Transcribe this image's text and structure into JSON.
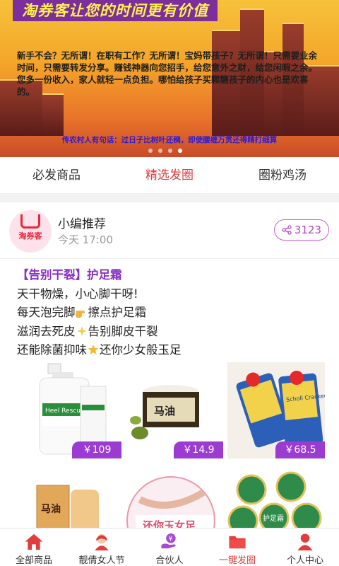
{
  "banner": {
    "title": "淘券客让您的时间更有价值",
    "text": "新手不会？无所谓！在职有工作？无所谓！宝妈带孩子？无所谓！只需要业余时间，只需要转发分享。赚钱神器向您招手，给您意外之财，给您闲暇之余。您多一份收入，家人就轻一点负担。哪怕给孩子买颗糖孩子的内心也是欢喜的。",
    "subtext": "传农村人有句话：过日子比树叶还稠，即使腰缠万贯还得精打细算"
  },
  "tabs": [
    {
      "label": "必发商品",
      "active": false
    },
    {
      "label": "精选发圈",
      "active": true
    },
    {
      "label": "圈粉鸡汤",
      "active": false
    }
  ],
  "post": {
    "avatar_text": "淘券客",
    "author": "小编推荐",
    "time": "今天 17:00",
    "share_count": "3123",
    "headline": "【告别干裂】护足霜",
    "lines": [
      "天干物燥，小心脚干呀!",
      "每天泡完脚",
      "擦点护足霜",
      "滋润去死皮",
      "告别脚皮干裂",
      "还能除菌抑味",
      "还你少女般玉足"
    ],
    "products": [
      {
        "name": "Heel Rescue FOOT CREAM",
        "price": "￥109"
      },
      {
        "name": "马油",
        "price": "￥14.9"
      },
      {
        "name": "Scholl Cracked Heel Repair Cream",
        "price": "￥68.5"
      }
    ],
    "products_row2": [
      {
        "name": "马油"
      },
      {
        "name": "还你玉女足"
      },
      {
        "name": "护足霜"
      }
    ]
  },
  "nav": [
    {
      "label": "全部商品",
      "icon": "home-icon",
      "active": false
    },
    {
      "label": "靓倩女人节",
      "icon": "girl-icon",
      "active": false
    },
    {
      "label": "合伙人",
      "icon": "money-hand-icon",
      "active": false
    },
    {
      "label": "一键发圈",
      "icon": "folder-icon",
      "active": true
    },
    {
      "label": "个人中心",
      "icon": "person-icon",
      "active": false
    }
  ],
  "colors": {
    "accent": "#e23d3d",
    "purple": "#9b3bd2",
    "brand_red": "#e6283a"
  }
}
